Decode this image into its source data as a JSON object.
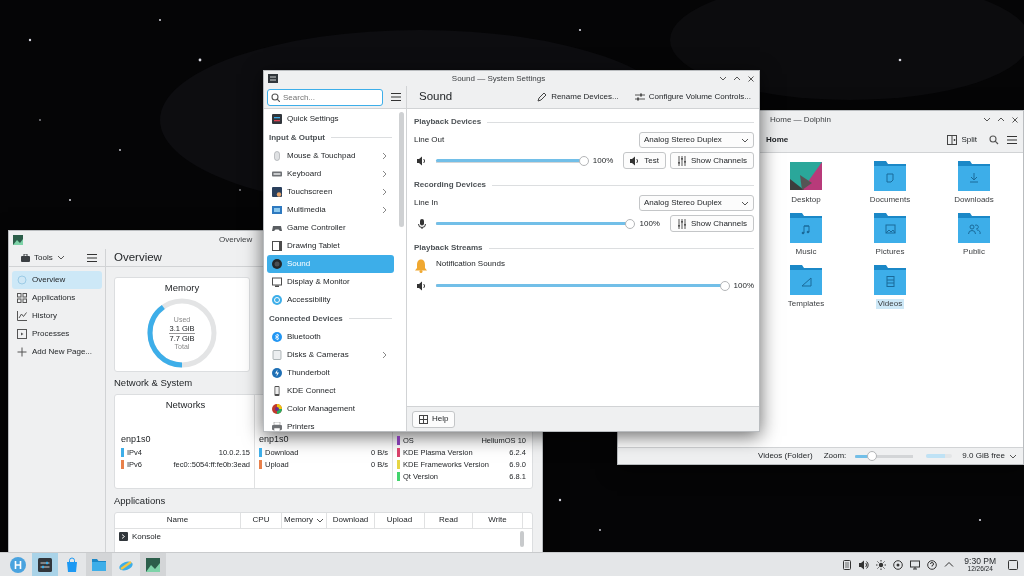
{
  "system_monitor": {
    "title": "Overview",
    "tools_label": "Tools",
    "page_title": "Overview",
    "sidebar": [
      {
        "label": "Overview",
        "selected": true
      },
      {
        "label": "Applications",
        "selected": false
      },
      {
        "label": "History",
        "selected": false
      },
      {
        "label": "Processes",
        "selected": false
      },
      {
        "label": "Add New Page...",
        "selected": false
      }
    ],
    "memory": {
      "title": "Memory",
      "used_label": "Used",
      "used": "3.1 GiB",
      "total": "7.7 GiB",
      "total_label": "Total",
      "level": 0.4
    },
    "network_section": {
      "title": "Network & System",
      "columns": [
        {
          "title": "Networks",
          "interface": "enp1s0",
          "rows": [
            {
              "label": "IPv4",
              "value": "10.0.2.15",
              "color": "#3daee9"
            },
            {
              "label": "IPv6",
              "value": "fec0::5054:ff:fe0b:3ead",
              "color": "#e8804a"
            }
          ]
        },
        {
          "interface": "enp1s0",
          "rows": [
            {
              "label": "Download",
              "value": "0 B/s",
              "color": "#3daee9"
            },
            {
              "label": "Upload",
              "value": "0 B/s",
              "color": "#e8804a"
            }
          ]
        },
        {
          "rows": [
            {
              "label": "OS",
              "value": "HeliumOS 10",
              "color": "#7e3aa8"
            },
            {
              "label": "KDE Plasma Version",
              "value": "6.2.4",
              "color": "#d8416a"
            },
            {
              "label": "KDE Frameworks Version",
              "value": "6.9.0",
              "color": "#e6d543"
            },
            {
              "label": "Qt Version",
              "value": "6.8.1",
              "color": "#43d46e"
            }
          ]
        }
      ]
    },
    "applications": {
      "title": "Applications",
      "columns": [
        {
          "label": "Name",
          "sorted": false
        },
        {
          "label": "CPU",
          "sorted": false
        },
        {
          "label": "Memory",
          "sorted": true
        },
        {
          "label": "Download",
          "sorted": false
        },
        {
          "label": "Upload",
          "sorted": false
        },
        {
          "label": "Read",
          "sorted": false
        },
        {
          "label": "Write",
          "sorted": false
        }
      ],
      "rows": [
        {
          "name": "Konsole"
        }
      ]
    }
  },
  "system_settings": {
    "title": "Sound — System Settings",
    "search": {
      "placeholder": "Search..."
    },
    "sidebar": [
      {
        "kind": "item",
        "label": "Quick Settings",
        "has_children": false,
        "selected": false
      },
      {
        "kind": "heading",
        "label": "Input & Output"
      },
      {
        "kind": "item",
        "label": "Mouse & Touchpad",
        "has_children": true,
        "selected": false
      },
      {
        "kind": "item",
        "label": "Keyboard",
        "has_children": true,
        "selected": false
      },
      {
        "kind": "item",
        "label": "Touchscreen",
        "has_children": true,
        "selected": false
      },
      {
        "kind": "item",
        "label": "Multimedia",
        "has_children": true,
        "selected": false
      },
      {
        "kind": "item",
        "label": "Game Controller",
        "has_children": false,
        "selected": false
      },
      {
        "kind": "item",
        "label": "Drawing Tablet",
        "has_children": false,
        "selected": false
      },
      {
        "kind": "item",
        "label": "Sound",
        "has_children": false,
        "selected": true
      },
      {
        "kind": "item",
        "label": "Display & Monitor",
        "has_children": false,
        "selected": false
      },
      {
        "kind": "item",
        "label": "Accessibility",
        "has_children": false,
        "selected": false
      },
      {
        "kind": "heading",
        "label": "Connected Devices"
      },
      {
        "kind": "item",
        "label": "Bluetooth",
        "has_children": false,
        "selected": false
      },
      {
        "kind": "item",
        "label": "Disks & Cameras",
        "has_children": true,
        "selected": false
      },
      {
        "kind": "item",
        "label": "Thunderbolt",
        "has_children": false,
        "selected": false
      },
      {
        "kind": "item",
        "label": "KDE Connect",
        "has_children": false,
        "selected": false
      },
      {
        "kind": "item",
        "label": "Color Management",
        "has_children": false,
        "selected": false
      },
      {
        "kind": "item",
        "label": "Printers",
        "has_children": false,
        "selected": false
      }
    ],
    "page_title": "Sound",
    "actions": [
      {
        "kind": "rename",
        "label": "Rename Devices..."
      },
      {
        "kind": "configure",
        "label": "Configure Volume Controls..."
      }
    ],
    "sections": [
      {
        "kind": "playback",
        "title": "Playback Devices",
        "devices": [
          {
            "name": "Line Out",
            "profile": "Analog Stereo Duplex",
            "level": 1,
            "reading": "100%",
            "buttons": [
              {
                "kind": "test",
                "label": "Test"
              },
              {
                "kind": "channels",
                "label": "Show Channels"
              }
            ]
          }
        ]
      },
      {
        "kind": "recording",
        "title": "Recording Devices",
        "devices": [
          {
            "name": "Line In",
            "profile": "Analog Stereo Duplex",
            "level": 1,
            "reading": "100%",
            "buttons": [
              {
                "kind": "channels",
                "label": "Show Channels"
              }
            ]
          }
        ]
      },
      {
        "kind": "streams",
        "title": "Playback Streams",
        "streams": [
          {
            "name": "Notification Sounds",
            "level": 1,
            "reading": "100%"
          }
        ]
      }
    ],
    "help": "Help"
  },
  "dolphin": {
    "title": "Home — Dolphin",
    "breadcrumb": "Home",
    "split": "Split",
    "items": [
      {
        "kind": "desktop",
        "label": "Desktop",
        "selected": false
      },
      {
        "kind": "documents",
        "label": "Documents",
        "selected": false
      },
      {
        "kind": "downloads",
        "label": "Downloads",
        "selected": false
      },
      {
        "kind": "music",
        "label": "Music",
        "selected": false
      },
      {
        "kind": "pictures",
        "label": "Pictures",
        "selected": false
      },
      {
        "kind": "public",
        "label": "Public",
        "selected": false
      },
      {
        "kind": "templates",
        "label": "Templates",
        "selected": false
      },
      {
        "kind": "videos",
        "label": "Videos",
        "selected": true
      }
    ],
    "status": "Videos (Folder)",
    "zoom_label": "Zoom:",
    "zoom": {
      "level": 0.28
    },
    "space": {
      "level": 0.7
    },
    "free": "9.0 GiB free"
  },
  "taskbar": {
    "apps": [
      {
        "kind": "launcher",
        "open": false,
        "active": false
      },
      {
        "kind": "settings",
        "open": true,
        "active": true
      },
      {
        "kind": "store",
        "open": false,
        "active": false
      },
      {
        "kind": "files",
        "open": true,
        "active": false
      },
      {
        "kind": "info",
        "open": false,
        "active": false
      },
      {
        "kind": "monitor",
        "open": true,
        "active": false
      }
    ],
    "time": "9:30 PM",
    "date": "12/26/24"
  }
}
